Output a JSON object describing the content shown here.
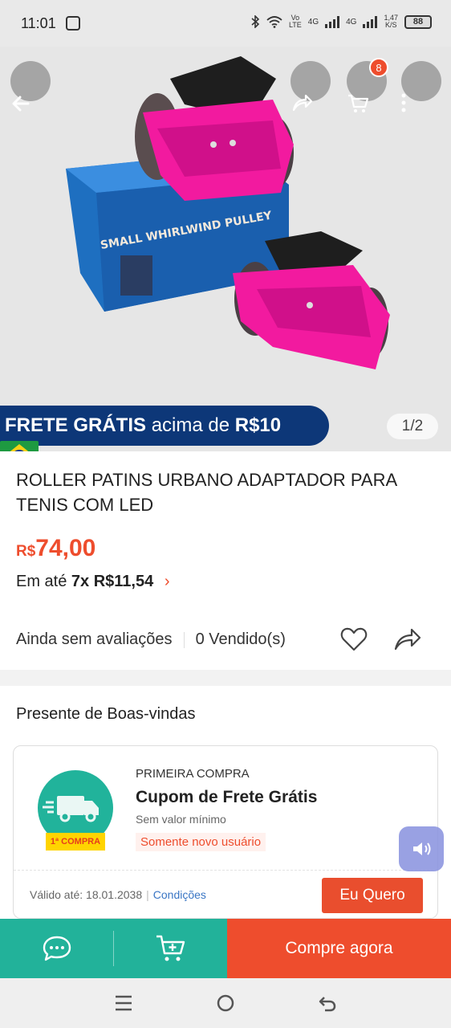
{
  "status_bar": {
    "time": "11:01",
    "network_labels": [
      "Vo",
      "LTE",
      "4G",
      "4G"
    ],
    "speed": "1,47",
    "speed_unit": "K/S",
    "battery": "88"
  },
  "header": {
    "cart_count": "8"
  },
  "hero": {
    "promo_bold": "FRETE GRÁTIS",
    "promo_rest": "acima de",
    "promo_amount": "R$10",
    "pager": "1/2",
    "box_print": "SMALL WHIRLWIND PULLEY"
  },
  "product": {
    "title": "ROLLER PATINS URBANO ADAPTADOR PARA TENIS COM LED",
    "currency": "R$",
    "price": "74,00",
    "installment_prefix": "Em até",
    "installment_value": "7x R$11,54",
    "reviews": "Ainda sem avaliações",
    "sold": "0 Vendido(s)"
  },
  "welcome": {
    "title": "Presente de Boas-vindas",
    "coupon": {
      "badge": "1ª COMPRA",
      "kicker": "PRIMEIRA COMPRA",
      "title": "Cupom de Frete Grátis",
      "subtitle": "Sem valor mínimo",
      "only_new": "Somente novo usuário",
      "valid_label": "Válido até: 18.01.2038",
      "conditions": "Condições",
      "button": "Eu Quero"
    }
  },
  "actions": {
    "buy_now": "Compre agora"
  },
  "colors": {
    "accent": "#ee4d2d",
    "teal": "#22b29a",
    "promo_bg": "#0d3778"
  }
}
